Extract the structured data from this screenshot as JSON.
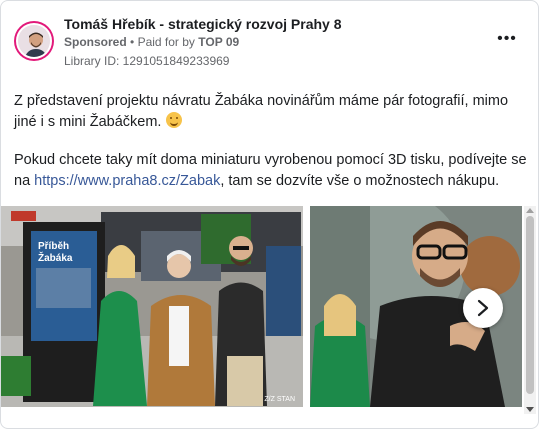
{
  "post": {
    "page_name": "Tomáš Hřebík - strategický rozvoj Prahy 8",
    "sponsored": "Sponsored",
    "paid_for": "Paid for by",
    "paid_by": "TOP 09",
    "library_id": "Library ID: 1291051849233969",
    "more_icon": "more-options-icon",
    "paragraph1": "Z představení projektu návratu Žabáka novinářům máme pár fotografií, mimo jiné i s mini Žabáčkem.",
    "emoji": "hugging-face-emoji",
    "paragraph2_before": "Pokud chcete taky mít doma miniaturu vyrobenou pomocí 3D tisku, podívejte se na",
    "link": "https://www.praha8.cz/Zabak",
    "paragraph2_after": ", tam se dozvíte vše o možnostech nákupu."
  },
  "gallery": {
    "photo1_caption": "Z/Z STAN",
    "poster_title": "Příběh Žabáka",
    "next_icon": "chevron-right-icon"
  },
  "colors": {
    "accent": "#e2197a",
    "link": "#385898",
    "muted": "#65676b"
  }
}
